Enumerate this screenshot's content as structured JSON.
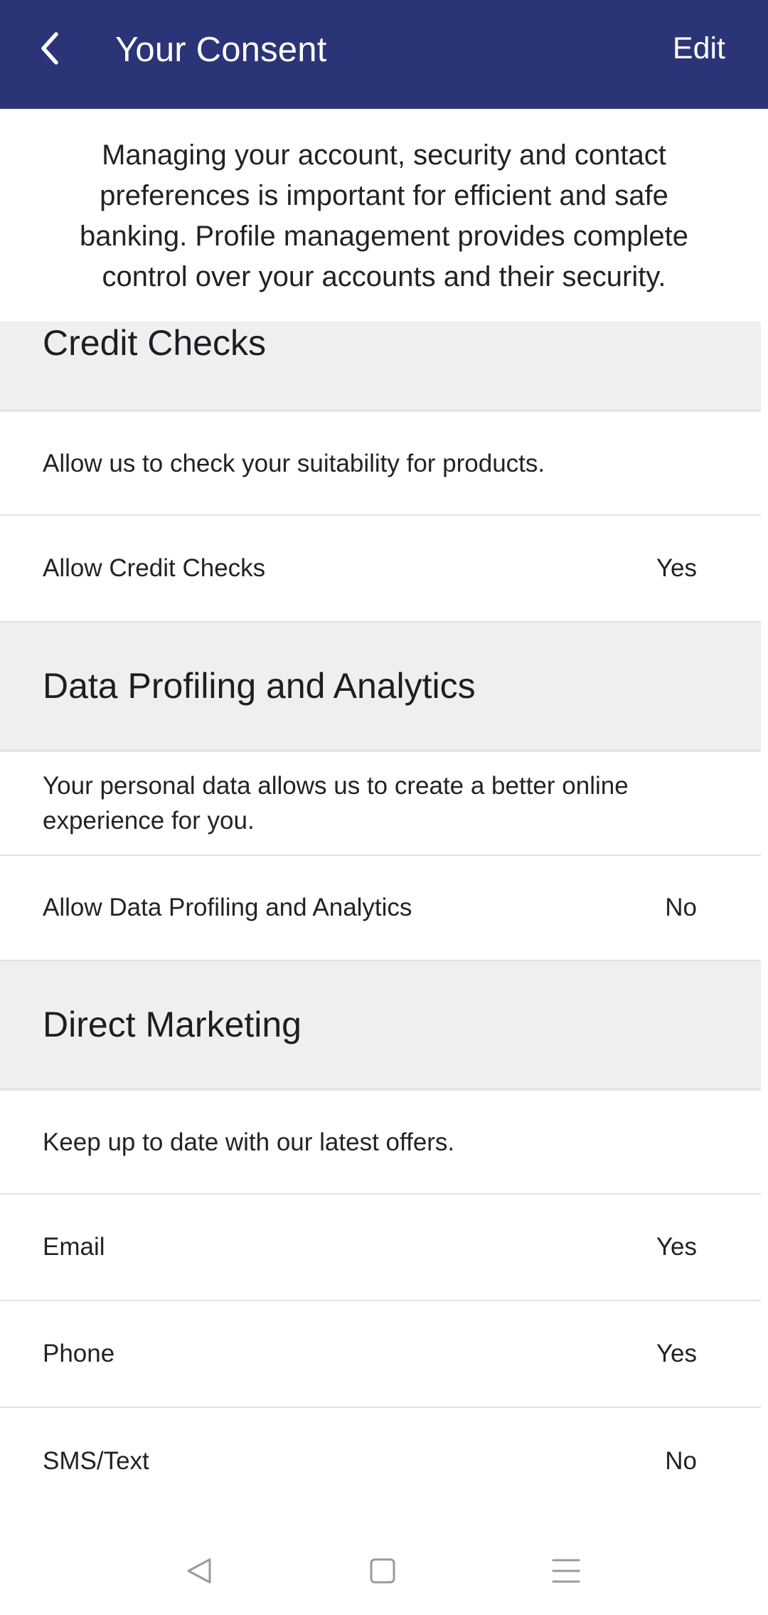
{
  "header": {
    "title": "Your Consent",
    "edit_label": "Edit",
    "back_icon": "chevron-left-icon",
    "background": "#2b3476"
  },
  "intro": {
    "text": "Managing your account, security and contact preferences is important for efficient and safe banking. Profile management provides complete control over your accounts and their security."
  },
  "sections": [
    {
      "title": "Credit Checks",
      "description": "Allow us to check your suitability for products.",
      "items": [
        {
          "label": "Allow Credit Checks",
          "value": "Yes"
        }
      ]
    },
    {
      "title": "Data Profiling and Analytics",
      "description": "Your personal data allows us to create a better online experience for you.",
      "items": [
        {
          "label": "Allow Data Profiling and Analytics",
          "value": "No"
        }
      ]
    },
    {
      "title": "Direct Marketing",
      "description": "Keep up to date with our latest offers.",
      "items": [
        {
          "label": "Email",
          "value": "Yes"
        },
        {
          "label": "Phone",
          "value": "Yes"
        },
        {
          "label": "SMS/Text",
          "value": "No"
        }
      ]
    }
  ],
  "navigation_bar": {
    "icons": [
      "back-triangle-icon",
      "home-square-icon",
      "menu-lines-icon"
    ]
  }
}
